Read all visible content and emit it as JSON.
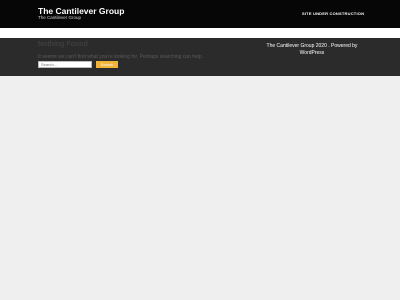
{
  "header": {
    "site_title": "The Cantilever Group",
    "tagline": "The Cantilever Group",
    "nav": [
      {
        "label": "SITE UNDER CONSTRUCTION"
      }
    ]
  },
  "main": {
    "heading": "Nothing Found",
    "message": "It seems we can't find what you're looking for. Perhaps searching can help.",
    "search": {
      "placeholder": "Search...",
      "button_label": "Search"
    }
  },
  "footer": {
    "credit": "The Cantilever Group 2020 . Powered by WordPress"
  },
  "colors": {
    "header_bg": "#060606",
    "content_band_bg": "#2b2b2b",
    "page_bg": "#efefef",
    "accent": "#f0b43a"
  }
}
